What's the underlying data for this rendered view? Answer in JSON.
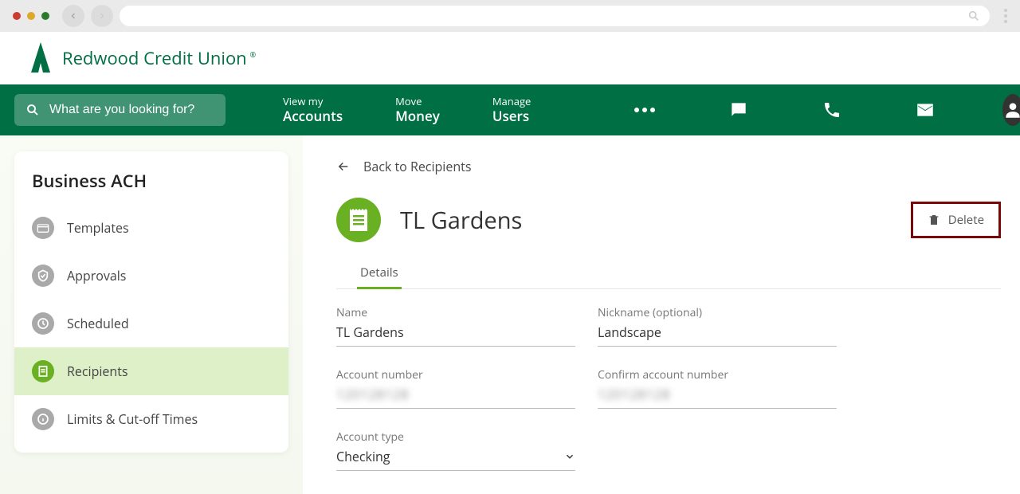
{
  "logo_text": "Redwood Credit Union",
  "search_placeholder": "What are you looking for?",
  "nav": [
    {
      "small": "View my",
      "big": "Accounts"
    },
    {
      "small": "Move",
      "big": "Money"
    },
    {
      "small": "Manage",
      "big": "Users"
    }
  ],
  "sidebar": {
    "title": "Business ACH",
    "items": [
      {
        "label": "Templates"
      },
      {
        "label": "Approvals"
      },
      {
        "label": "Scheduled"
      },
      {
        "label": "Recipients"
      },
      {
        "label": "Limits & Cut-off Times"
      }
    ]
  },
  "back_label": "Back to Recipients",
  "page_title": "TL Gardens",
  "delete_label": "Delete",
  "tab_label": "Details",
  "fields": {
    "name_label": "Name",
    "name_value": "TL Gardens",
    "nick_label": "Nickname (optional)",
    "nick_value": "Landscape",
    "acct_label": "Account number",
    "acct_value": "120128128",
    "confirm_label": "Confirm account number",
    "confirm_value": "120128128",
    "type_label": "Account type",
    "type_value": "Checking"
  }
}
